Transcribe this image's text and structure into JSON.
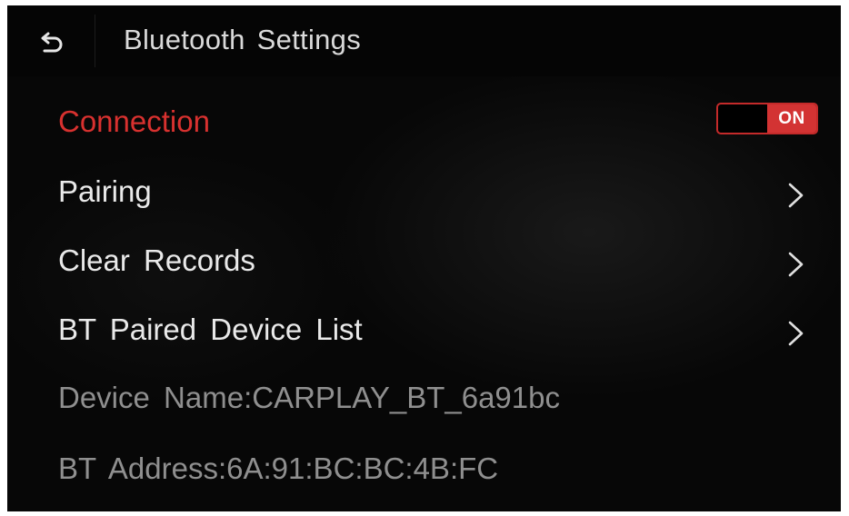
{
  "header": {
    "back_icon": "back-arrow-icon",
    "title": "Bluetooth Settings"
  },
  "colors": {
    "accent_red": "#d8312f",
    "text_primary": "#e9e9e9",
    "text_secondary": "#8f8f8f",
    "background": "#070707"
  },
  "menu": {
    "connection": {
      "label": "Connection",
      "toggle_state": "ON",
      "enabled": true
    },
    "pairing": {
      "label": "Pairing",
      "icon": "chevron-right-icon"
    },
    "clear_records": {
      "label": "Clear Records",
      "icon": "chevron-right-icon"
    },
    "paired_devices": {
      "label": "BT Paired Device List",
      "icon": "chevron-right-icon"
    }
  },
  "info": {
    "device_name": "Device Name:CARPLAY_BT_6a91bc",
    "bt_address": "BT Address:6A:91:BC:BC:4B:FC"
  }
}
